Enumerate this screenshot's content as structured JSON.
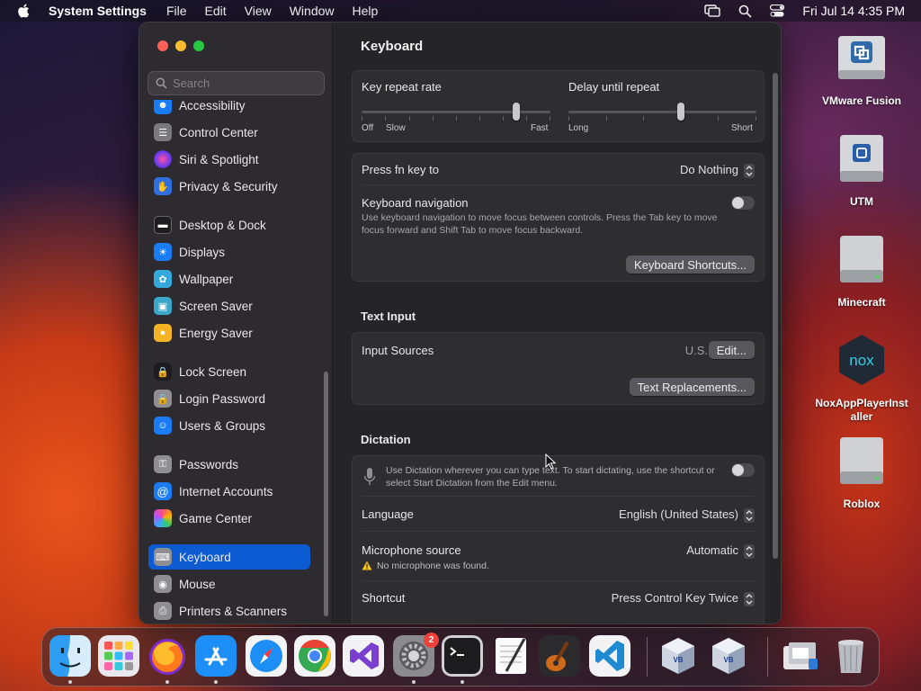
{
  "menubar": {
    "app_name": "System Settings",
    "menus": [
      "File",
      "Edit",
      "View",
      "Window",
      "Help"
    ],
    "clock": "Fri Jul 14  4:35 PM"
  },
  "sidebar": {
    "search_placeholder": "Search",
    "items": [
      {
        "label": "Accessibility",
        "icon": "accessibility-icon",
        "color": "#1a7cf5"
      },
      {
        "label": "Control Center",
        "icon": "control-center-icon",
        "color": "#7a7a7e"
      },
      {
        "label": "Siri & Spotlight",
        "icon": "siri-icon",
        "color": "#b13ad6"
      },
      {
        "label": "Privacy & Security",
        "icon": "hand-icon",
        "color": "#2f6fe0"
      },
      {
        "label": "Desktop & Dock",
        "icon": "dock-icon",
        "color": "#1d1d1f"
      },
      {
        "label": "Displays",
        "icon": "sun-icon",
        "color": "#1a7cf5"
      },
      {
        "label": "Wallpaper",
        "icon": "flower-icon",
        "color": "#34aadc"
      },
      {
        "label": "Screen Saver",
        "icon": "screen-saver-icon",
        "color": "#3aa7c9"
      },
      {
        "label": "Energy Saver",
        "icon": "bulb-icon",
        "color": "#f4b322"
      },
      {
        "label": "Lock Screen",
        "icon": "lock-icon",
        "color": "#1d1d1f"
      },
      {
        "label": "Login Password",
        "icon": "lock-icon",
        "color": "#8e8e93"
      },
      {
        "label": "Users & Groups",
        "icon": "users-icon",
        "color": "#1a7cf5"
      },
      {
        "label": "Passwords",
        "icon": "key-icon",
        "color": "#8e8e93"
      },
      {
        "label": "Internet Accounts",
        "icon": "at-icon",
        "color": "#1a7cf5"
      },
      {
        "label": "Game Center",
        "icon": "game-center-icon",
        "color": "#e8e8e8"
      },
      {
        "label": "Keyboard",
        "icon": "keyboard-icon",
        "color": "#8e8e93",
        "selected": true
      },
      {
        "label": "Mouse",
        "icon": "mouse-icon",
        "color": "#8e8e93"
      },
      {
        "label": "Printers & Scanners",
        "icon": "printer-icon",
        "color": "#8e8e93"
      }
    ]
  },
  "content": {
    "title": "Keyboard",
    "key_repeat": {
      "label": "Key repeat rate",
      "left": "Off",
      "left2": "Slow",
      "right": "Fast",
      "value_fraction": 0.82
    },
    "delay_repeat": {
      "label": "Delay until repeat",
      "left": "Long",
      "right": "Short",
      "value_fraction": 0.6
    },
    "press_fn": {
      "label": "Press fn key to",
      "value": "Do Nothing"
    },
    "keyboard_nav": {
      "label": "Keyboard navigation",
      "desc": "Use keyboard navigation to move focus between controls. Press the Tab key to move focus forward and Shift Tab to move focus backward.",
      "enabled": false
    },
    "keyboard_shortcuts_button": "Keyboard Shortcuts...",
    "text_input_title": "Text Input",
    "input_sources": {
      "label": "Input Sources",
      "value": "U.S.",
      "edit_button": "Edit..."
    },
    "text_replacements_button": "Text Replacements...",
    "dictation_title": "Dictation",
    "dictation": {
      "desc": "Use Dictation wherever you can type text. To start dictating, use the shortcut or select Start Dictation from the Edit menu.",
      "enabled": false
    },
    "language": {
      "label": "Language",
      "value": "English (United States)"
    },
    "microphone": {
      "label": "Microphone source",
      "value": "Automatic",
      "warning": "No microphone was found."
    },
    "shortcut": {
      "label": "Shortcut",
      "value": "Press Control Key Twice"
    }
  },
  "desktop_icons": [
    {
      "name": "VMware Fusion",
      "icon": "vmware-fusion-icon"
    },
    {
      "name": "UTM",
      "icon": "utm-disk-icon"
    },
    {
      "name": "Minecraft",
      "icon": "disk-icon"
    },
    {
      "name": "NoxAppPlayerInstaller",
      "icon": "nox-icon"
    },
    {
      "name": "Roblox",
      "icon": "disk-icon"
    }
  ],
  "dock": {
    "apps": [
      "Finder",
      "Launchpad",
      "Firefox",
      "App Store",
      "Safari",
      "Chrome",
      "Visual Studio",
      "System Settings",
      "Terminal",
      "TextEdit",
      "GarageBand",
      "Visual Studio Code",
      "VirtualBox",
      "VirtualBox VM",
      "Downloads",
      "Trash"
    ],
    "settings_badge": "2"
  }
}
